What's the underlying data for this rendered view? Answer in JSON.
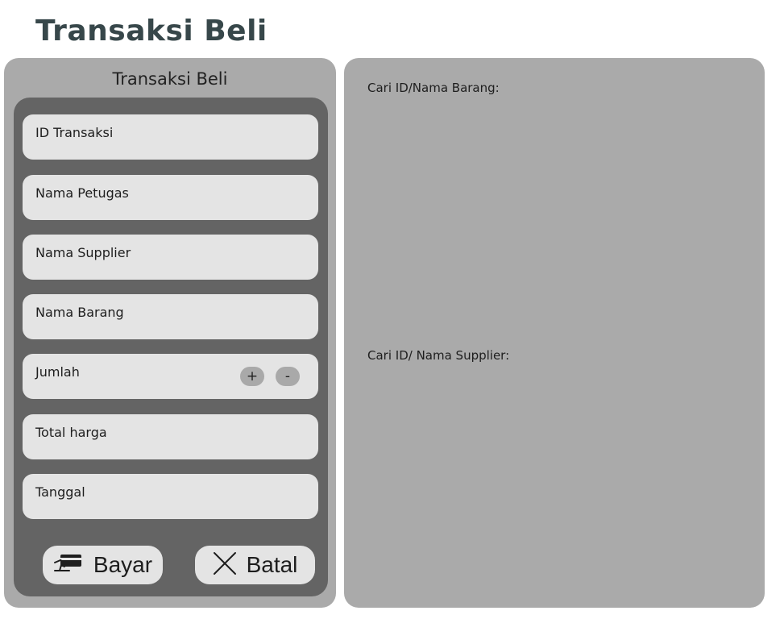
{
  "app": {
    "title": "Transaksi Beli"
  },
  "form": {
    "title": "Transaksi Beli",
    "fields": [
      {
        "label": "ID Transaksi"
      },
      {
        "label": "Nama Petugas"
      },
      {
        "label": "Nama Supplier"
      },
      {
        "label": "Nama Barang"
      },
      {
        "label": "Jumlah"
      },
      {
        "label": "Total harga"
      },
      {
        "label": "Tanggal"
      }
    ],
    "stepper": {
      "plus_label": "+",
      "minus_label": "-"
    },
    "buttons": {
      "pay": {
        "label": "Bayar",
        "icon": "card-payment-icon"
      },
      "cancel": {
        "label": "Batal",
        "icon": "close-icon"
      }
    }
  },
  "search": {
    "item_label": "Cari ID/Nama Barang:",
    "supplier_label": "Cari ID/ Nama Supplier:"
  }
}
